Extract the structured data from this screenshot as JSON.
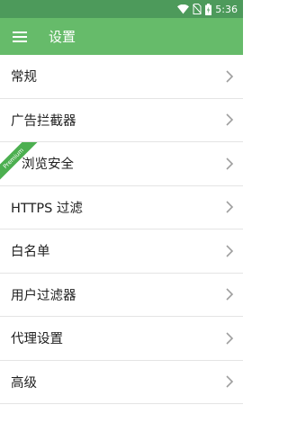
{
  "status_bar": {
    "time": "5:36",
    "icons": [
      "wifi-icon",
      "no-sim-icon",
      "battery-icon"
    ]
  },
  "app_bar": {
    "menu_icon": "hamburger-menu-icon",
    "title": "设置"
  },
  "settings": {
    "items": [
      {
        "label": "常规"
      },
      {
        "label": "广告拦截器"
      },
      {
        "label": "浏览安全",
        "badge": "Premium"
      },
      {
        "label": "HTTPS 过滤"
      },
      {
        "label": "白名单"
      },
      {
        "label": "用户过滤器"
      },
      {
        "label": "代理设置"
      },
      {
        "label": "高级"
      }
    ]
  },
  "colors": {
    "status_bar": "#4d9a5b",
    "app_bar": "#66bb6a",
    "ribbon": "#4caf50",
    "divider": "#e4e4e4",
    "text": "#212121",
    "chevron": "#9e9e9e"
  }
}
